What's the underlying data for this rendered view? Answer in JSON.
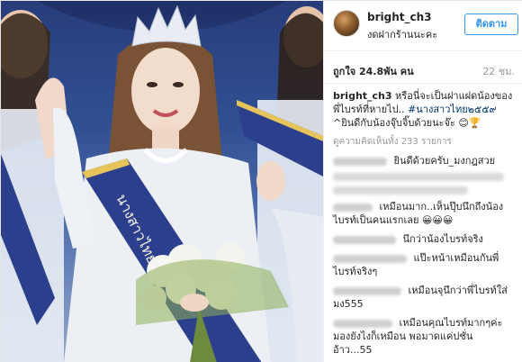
{
  "post": {
    "username": "bright_ch3",
    "location": "งดฝากร้านนะคะ",
    "follow_label": "ติดตาม",
    "likes": "ถูกใจ 24.8พัน คน",
    "time": "22 ชม.",
    "caption_user": "bright_ch3",
    "caption_text": "หรือนี่จะเป็นฝาแฝดน้องของพี่ไบรท์ที่หายไป.. ",
    "caption_hashtag": "#นางสาวไทย๒๕๕๙",
    "caption_text2": " ^ยินดีกับน้องจุ๊บจิ๊บด้วยนะจ๊ะ 😊🏆",
    "view_all": "ดูความคิดเห็นทั้ง 233 รายการ"
  },
  "comments": [
    {
      "text": "ยินดีด้วยครับ_มงกฎสวย"
    },
    {
      "text": "เหมือนมาก..เห็นปุ๊บนึกถึงน้องไบรท์เป็นคนแรกเลย 😀😀😀"
    },
    {
      "text": "นึกว่าน้องไบรท์จริง"
    },
    {
      "text": "แป๊ะหน้าเหมือนกันพี่ไบรท์จริงๆ"
    },
    {
      "text": "เหมือนจุนึกว่าพี่ไบรท์ใส่มง555"
    },
    {
      "text": "เหมือนคุณไบรท์มากๆค่ะ มองยังไงก็เหมือน พอมาดแค่ปชั่น อ้าว...55"
    }
  ],
  "photo": {
    "sash_text": "นางสาวไทย",
    "colors": {
      "sash": "#2b3f8c",
      "sash_trim": "#e7c45a",
      "flowers": "#f4f4ee",
      "dress": "#eceff4",
      "crown": "#e9edf3"
    }
  }
}
